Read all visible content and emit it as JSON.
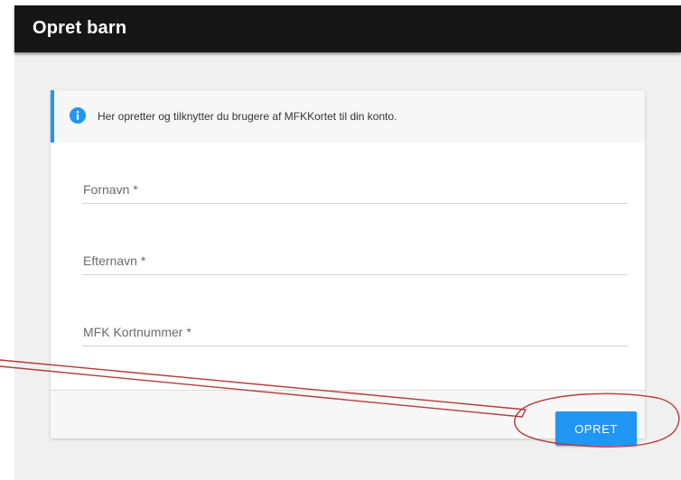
{
  "header": {
    "title": "Opret barn"
  },
  "info_banner": {
    "icon": "info-icon",
    "text": "Her opretter og tilknytter du brugere af MFKKortet til din konto."
  },
  "form": {
    "first_name": {
      "label": "Fornavn *",
      "value": ""
    },
    "last_name": {
      "label": "Efternavn *",
      "value": ""
    },
    "card_number": {
      "label": "MFK Kortnummer *",
      "value": ""
    }
  },
  "footer": {
    "submit_label": "OPRET"
  },
  "colors": {
    "app_bar": "#161616",
    "accent": "#2196f3",
    "page_background": "#f0f0f0",
    "annotation": "#b93a3a"
  }
}
